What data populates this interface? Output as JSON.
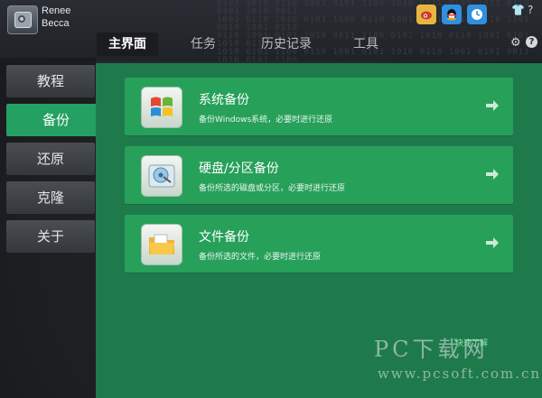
{
  "brand": {
    "line1": "Renee",
    "line2": "Becca"
  },
  "window_buttons": {
    "shirt": "👕",
    "help": "?"
  },
  "tabs": [
    {
      "label": "主界面",
      "active": true
    },
    {
      "label": "任务",
      "active": false
    },
    {
      "label": "历史记录",
      "active": false
    },
    {
      "label": "工具",
      "active": false
    }
  ],
  "sidebar": [
    {
      "label": "教程",
      "active": false
    },
    {
      "label": "备份",
      "active": true
    },
    {
      "label": "还原",
      "active": false
    },
    {
      "label": "克隆",
      "active": false
    },
    {
      "label": "关于",
      "active": false
    }
  ],
  "cards": [
    {
      "title": "系统备份",
      "desc": "备份Windows系统，必要时进行还原",
      "icon": "windows-logo-icon"
    },
    {
      "title": "硬盘/分区备份",
      "desc": "备份所选的磁盘或分区，必要时进行还原",
      "icon": "hard-disk-icon"
    },
    {
      "title": "文件备份",
      "desc": "备份所选的文件，必要时进行还原",
      "icon": "folder-icon"
    }
  ],
  "watermark": {
    "big": "PC下载网",
    "url": "www.pcsoft.com.cn",
    "small": "快速了解"
  },
  "colors": {
    "accent_green": "#27a05a",
    "panel_green": "#1f7a4b",
    "dark": "#1d1f24"
  }
}
